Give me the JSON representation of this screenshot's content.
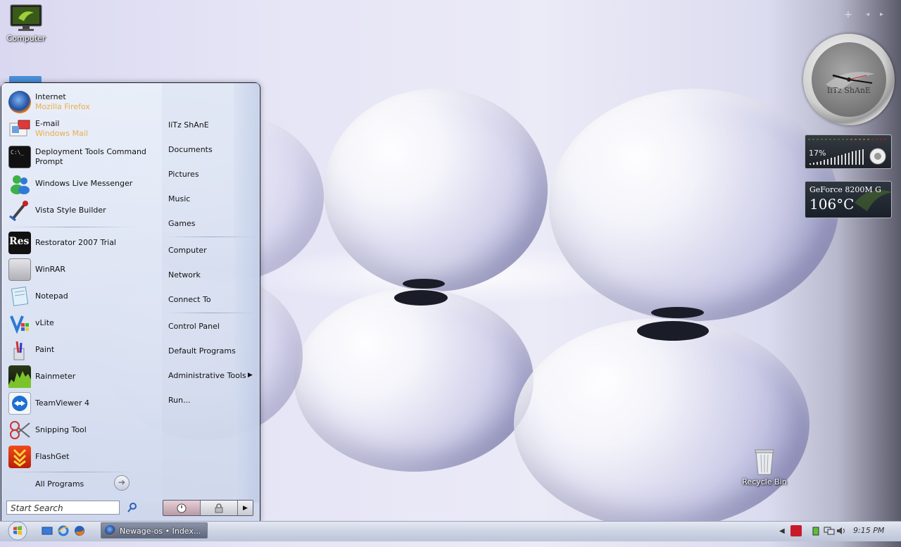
{
  "desktop": {
    "computer_label": "Computer",
    "recycle_bin_label": "Recycle Bin"
  },
  "start_menu": {
    "pinned": [
      {
        "label": "Internet",
        "sub": "Mozilla Firefox",
        "icon": "firefox-icon"
      },
      {
        "label": "E-mail",
        "sub": "Windows Mail",
        "icon": "mail-icon"
      }
    ],
    "recent": [
      {
        "label": "Deployment Tools Command Prompt",
        "icon": "cmd-icon"
      },
      {
        "label": "Windows Live Messenger",
        "icon": "messenger-icon"
      },
      {
        "label": "Vista Style Builder",
        "icon": "style-builder-icon"
      },
      {
        "label": "Restorator 2007 Trial",
        "icon": "restorator-icon"
      },
      {
        "label": "WinRAR",
        "icon": "winrar-icon"
      },
      {
        "label": "Notepad",
        "icon": "notepad-icon"
      },
      {
        "label": "vLite",
        "icon": "vlite-icon"
      },
      {
        "label": "Paint",
        "icon": "paint-icon"
      },
      {
        "label": "Rainmeter",
        "icon": "rainmeter-icon"
      },
      {
        "label": "TeamViewer 4",
        "icon": "teamviewer-icon"
      },
      {
        "label": "Snipping Tool",
        "icon": "scissors-icon"
      },
      {
        "label": "FlashGet",
        "icon": "flashget-icon"
      }
    ],
    "all_programs": "All Programs",
    "search_placeholder": "Start Search",
    "right_items": [
      "IiTz ShAnE",
      "Documents",
      "Pictures",
      "Music",
      "Games",
      "Computer",
      "Network",
      "Connect To",
      "Control Panel",
      "Default Programs",
      "Administrative Tools",
      "Run..."
    ],
    "restorator_glyph": "Res"
  },
  "taskbar": {
    "task_button_label": "Newage-os • Index...",
    "clock": "9:15 PM"
  },
  "gadgets": {
    "controls": [
      "+",
      "◂",
      "▸"
    ],
    "clock_label": "IiTz ShAnE",
    "volume_percent": "17%",
    "gpu_name": "GeForce 8200M G",
    "gpu_temp": "106°C"
  }
}
